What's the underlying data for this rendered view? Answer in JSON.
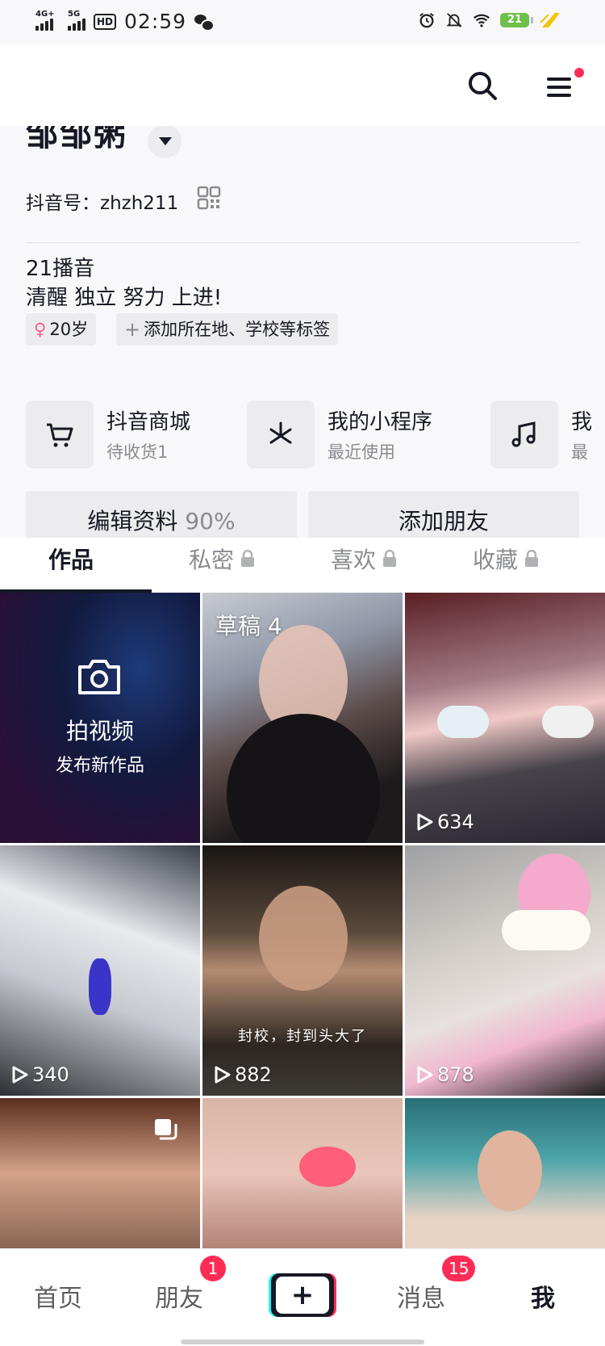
{
  "status_bar": {
    "network1": "4G+",
    "network2": "5G",
    "hd": "HD",
    "time": "02:59",
    "battery": "21"
  },
  "profile": {
    "nickname": "邹邹粥",
    "douyin_id": "抖音号：zhzh211",
    "bio_line1": "21播音",
    "bio_line2": "清醒 独立 努力 上进!",
    "tag_age": "20岁",
    "tag_add": "添加所在地、学校等标签"
  },
  "services": [
    {
      "title": "抖音商城",
      "subtitle": "待收货1",
      "icon": "cart-icon"
    },
    {
      "title": "我的小程序",
      "subtitle": "最近使用",
      "icon": "mini-program-icon"
    },
    {
      "title": "我",
      "subtitle": "最",
      "icon": "music-icon"
    }
  ],
  "actions": {
    "edit_label": "编辑资料",
    "edit_percent": "90%",
    "add_friend_label": "添加朋友"
  },
  "tabs": [
    {
      "label": "作品",
      "active": true,
      "locked": false
    },
    {
      "label": "私密",
      "active": false,
      "locked": true
    },
    {
      "label": "喜欢",
      "active": false,
      "locked": true
    },
    {
      "label": "收藏",
      "active": false,
      "locked": true
    }
  ],
  "grid": {
    "camera_title": "拍视频",
    "camera_subtitle": "发布新作品",
    "draft_label": "草稿 4",
    "counts": [
      "634",
      "340",
      "882",
      "878"
    ],
    "caption": "封校，封到头大了"
  },
  "bottom_nav": {
    "home": "首页",
    "friends": "朋友",
    "friends_badge": "1",
    "messages": "消息",
    "messages_badge": "15",
    "me": "我"
  },
  "colors": {
    "accent_red": "#fe2c55",
    "accent_cyan": "#25f4ee",
    "text_primary": "#161823",
    "text_secondary": "#8a8b91",
    "bg_gray": "#f8f8fa"
  }
}
